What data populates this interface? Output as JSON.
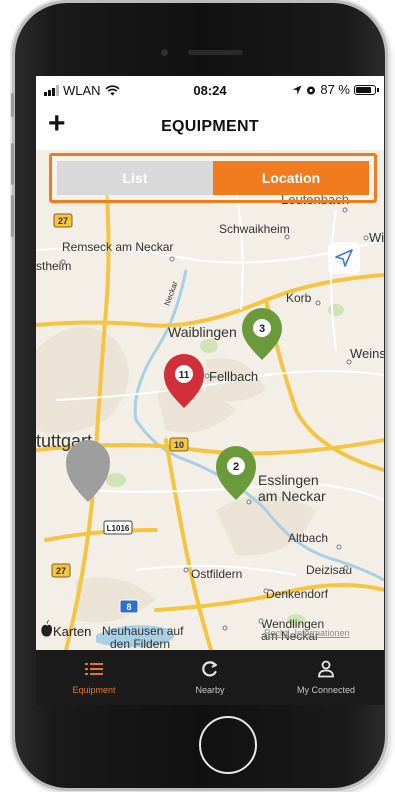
{
  "status_bar": {
    "carrier": "WLAN",
    "time": "08:24",
    "battery_percent": "87 %",
    "battery_level": 0.87
  },
  "nav": {
    "title": "EQUIPMENT",
    "add_icon": "plus-icon"
  },
  "segment": {
    "options": [
      "List",
      "Location"
    ],
    "selected": "Location",
    "accent_color": "#f07c1f"
  },
  "map": {
    "place_labels": [
      "Leutenbach",
      "Schwaikheim",
      "Wi",
      "Remseck am Neckar",
      "stheim",
      "Neckar",
      "Korb",
      "Waiblingen",
      "Weins",
      "Fellbach",
      "tuttgart",
      "Esslingen",
      "am Neckar",
      "Altbach",
      "Ostfildern",
      "Deizisau",
      "Denkendorf",
      "Wendlingen",
      "am Neckar",
      "Neuhausen auf",
      "den Fildern"
    ],
    "road_badges": [
      "27",
      "10",
      "L1016",
      "27",
      "8"
    ],
    "attribution_logo": "Karten",
    "attribution_legal": "Rechtl. Informationen",
    "markers": [
      {
        "label": "3",
        "color": "#6a9a3a"
      },
      {
        "label": "11",
        "color": "#d32f3a"
      },
      {
        "label": "2",
        "color": "#6a9a3a"
      },
      {
        "label": "",
        "color": "#9e9e9e"
      }
    ]
  },
  "tabbar": {
    "tabs": [
      {
        "label": "Equipment",
        "icon": "list-icon"
      },
      {
        "label": "Nearby",
        "icon": "refresh-icon"
      },
      {
        "label": "My Connected",
        "icon": "person-icon"
      }
    ],
    "active_color": "#e07a22"
  }
}
